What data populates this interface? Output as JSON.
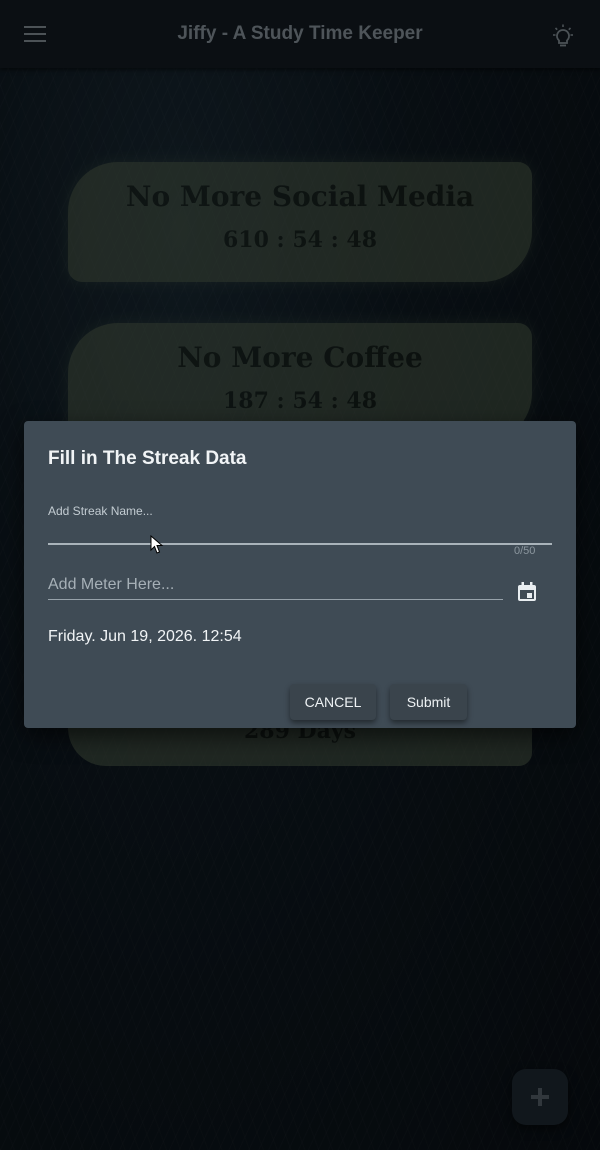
{
  "appbar": {
    "title": "Jiffy - A Study Time Keeper",
    "menu_icon": "menu-icon",
    "theme_icon": "lightbulb-icon"
  },
  "cards": [
    {
      "title": "No More Social Media",
      "value": "610 : 54 : 48"
    },
    {
      "title": "No More Coffee",
      "value": "187 : 54 : 48"
    },
    {
      "value": "289 Days"
    }
  ],
  "dialog": {
    "title": "Fill in The Streak Data",
    "name_label": "Add Streak Name...",
    "name_value": "",
    "name_counter": "0/50",
    "meter_placeholder": "Add Meter Here...",
    "calendar_icon": "calendar-icon",
    "date_text": "Friday. Jun 19, 2026. 12:54",
    "cancel_label": "CANCEL",
    "submit_label": "Submit"
  },
  "fab": {
    "icon": "plus-icon",
    "label": "+"
  },
  "colors": {
    "card": "#5f6f57",
    "dialog": "#3f4b55",
    "appbar": "#141d24"
  }
}
